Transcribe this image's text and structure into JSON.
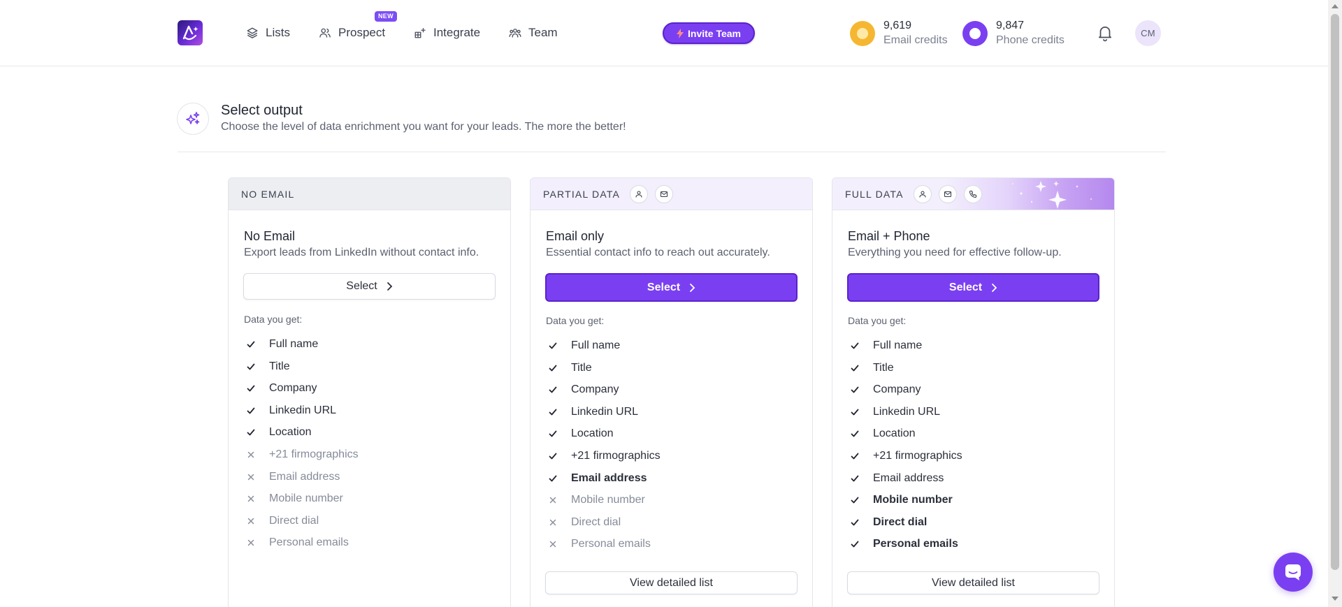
{
  "header": {
    "nav": [
      {
        "label": "Lists",
        "icon": "layers-icon"
      },
      {
        "label": "Prospect",
        "icon": "users-icon",
        "badge": "NEW"
      },
      {
        "label": "Integrate",
        "icon": "grid-plus-icon"
      },
      {
        "label": "Team",
        "icon": "team-icon"
      }
    ],
    "invite_label": "Invite Team",
    "credits": [
      {
        "value": "9,619",
        "label": "Email credits",
        "color": "#f5b731"
      },
      {
        "value": "9,847",
        "label": "Phone credits",
        "color": "#7b3ff2"
      }
    ],
    "avatar_initials": "CM"
  },
  "section": {
    "title": "Select output",
    "subtitle": "Choose the level of data enrichment you want for your leads. The more the better!"
  },
  "cards": [
    {
      "category": "NO EMAIL",
      "title": "No Email",
      "desc": "Export leads from LinkedIn without contact info.",
      "select_label": "Select",
      "data_label": "Data you get:",
      "features": [
        {
          "label": "Full name",
          "state": "check"
        },
        {
          "label": "Title",
          "state": "check"
        },
        {
          "label": "Company",
          "state": "check"
        },
        {
          "label": "Linkedin URL",
          "state": "check"
        },
        {
          "label": "Location",
          "state": "check"
        },
        {
          "label": "+21 firmographics",
          "state": "cross"
        },
        {
          "label": "Email address",
          "state": "cross"
        },
        {
          "label": "Mobile number",
          "state": "cross"
        },
        {
          "label": "Direct dial",
          "state": "cross"
        },
        {
          "label": "Personal emails",
          "state": "cross"
        }
      ]
    },
    {
      "category": "PARTIAL DATA",
      "title": "Email only",
      "desc": "Essential contact info to reach out accurately.",
      "select_label": "Select",
      "data_label": "Data you get:",
      "view_label": "View detailed list",
      "features": [
        {
          "label": "Full name",
          "state": "check"
        },
        {
          "label": "Title",
          "state": "check"
        },
        {
          "label": "Company",
          "state": "check"
        },
        {
          "label": "Linkedin URL",
          "state": "check"
        },
        {
          "label": "Location",
          "state": "check"
        },
        {
          "label": "+21 firmographics",
          "state": "check"
        },
        {
          "label": "Email address",
          "state": "check-bold"
        },
        {
          "label": "Mobile number",
          "state": "cross"
        },
        {
          "label": "Direct dial",
          "state": "cross"
        },
        {
          "label": "Personal emails",
          "state": "cross"
        }
      ]
    },
    {
      "category": "FULL DATA",
      "title": "Email + Phone",
      "desc": "Everything you need for effective follow-up.",
      "select_label": "Select",
      "data_label": "Data you get:",
      "view_label": "View detailed list",
      "features": [
        {
          "label": "Full name",
          "state": "check"
        },
        {
          "label": "Title",
          "state": "check"
        },
        {
          "label": "Company",
          "state": "check"
        },
        {
          "label": "Linkedin URL",
          "state": "check"
        },
        {
          "label": "Location",
          "state": "check"
        },
        {
          "label": "+21 firmographics",
          "state": "check"
        },
        {
          "label": "Email address",
          "state": "check"
        },
        {
          "label": "Mobile number",
          "state": "check-bold"
        },
        {
          "label": "Direct dial",
          "state": "check-bold"
        },
        {
          "label": "Personal emails",
          "state": "check-bold"
        }
      ]
    }
  ],
  "colors": {
    "accent": "#7b3ff2",
    "accent_dark": "#5a22cc"
  }
}
